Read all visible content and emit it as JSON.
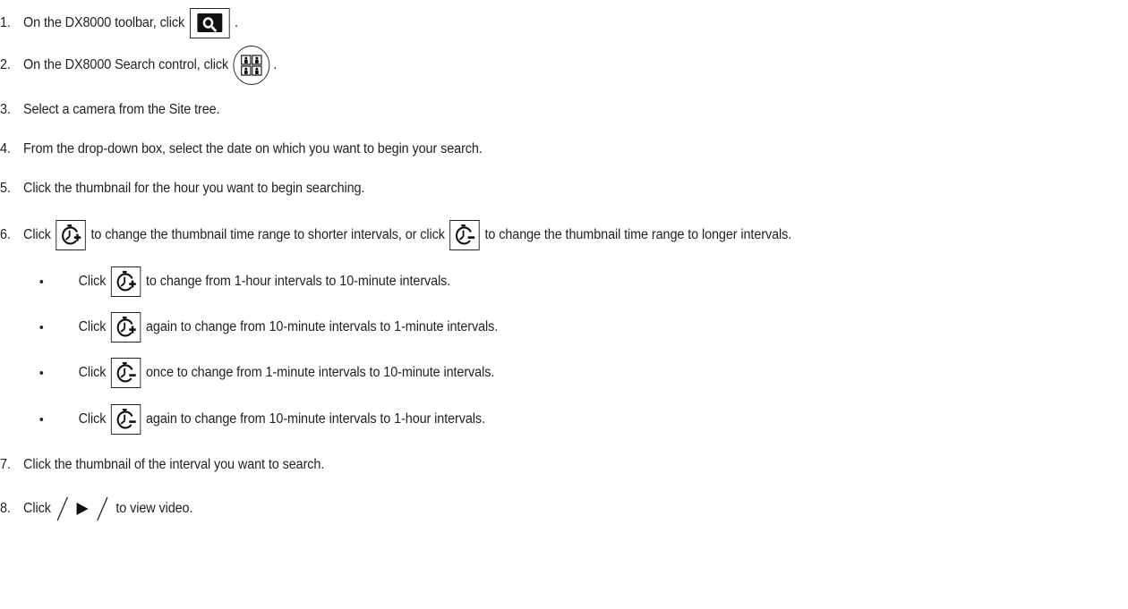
{
  "steps": [
    {
      "num": "1.",
      "text_a": "On the DX8000 toolbar, click",
      "text_b": "."
    },
    {
      "num": "2.",
      "text_a": "On the DX8000 Search control, click",
      "text_b": "."
    },
    {
      "num": "3.",
      "text": "Select a camera from the Site tree."
    },
    {
      "num": "4.",
      "text": "From the drop-down box, select the date on which you want to begin your search."
    },
    {
      "num": "5.",
      "text": "Click the thumbnail for the hour you want to begin searching."
    },
    {
      "num": "6.",
      "text_a": "Click",
      "text_b": "to change the thumbnail time range to shorter intervals, or click",
      "text_c": "to change the thumbnail time range to longer intervals."
    },
    {
      "num": "7.",
      "text": "Click the thumbnail of the interval you want to search."
    },
    {
      "num": "8.",
      "text_a": "Click",
      "text_b": "to view video."
    }
  ],
  "bullets": [
    {
      "mark": "•",
      "text_a": "Click",
      "text_b": "to change from 1-hour intervals to 10-minute intervals."
    },
    {
      "mark": "•",
      "text_a": "Click",
      "text_b": "again to change from 10-minute intervals to 1-minute intervals."
    },
    {
      "mark": "•",
      "text_a": "Click",
      "text_b": "once to change from 1-minute intervals to 10-minute intervals."
    },
    {
      "mark": "•",
      "text_a": "Click",
      "text_b": "again to change from 10-minute intervals to 1-hour intervals."
    }
  ],
  "icons": {
    "search": "search-toolbar-icon",
    "thumbnail": "thumbnail-search-icon",
    "zoom_in": "time-range-zoom-in-icon",
    "zoom_out": "time-range-zoom-out-icon",
    "play": "play-icon"
  }
}
